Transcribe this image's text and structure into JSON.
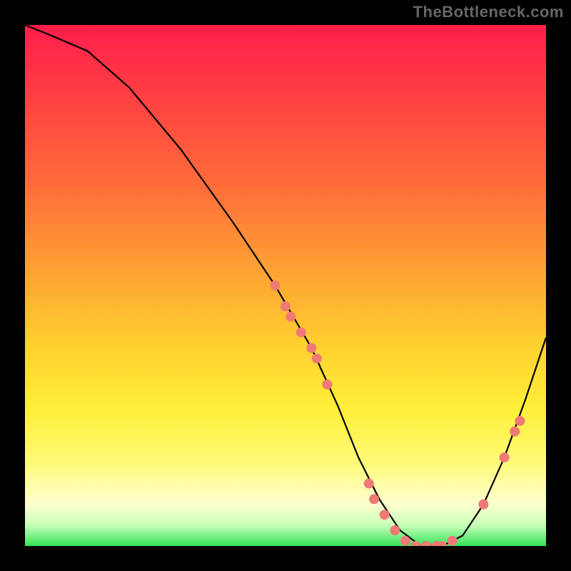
{
  "watermark": "TheBottleneck.com",
  "chart_data": {
    "type": "line",
    "title": "",
    "xlabel": "",
    "ylabel": "",
    "xlim": [
      0,
      100
    ],
    "ylim": [
      0,
      100
    ],
    "series": [
      {
        "name": "bottleneck-curve",
        "x": [
          0,
          5,
          12,
          20,
          30,
          40,
          48,
          55,
          60,
          64,
          68,
          72,
          76,
          80,
          84,
          88,
          92,
          96,
          100
        ],
        "values": [
          100,
          98,
          95,
          88,
          76,
          62,
          50,
          38,
          27,
          17,
          9,
          3,
          0,
          0,
          2,
          8,
          17,
          28,
          40
        ]
      }
    ],
    "markers": {
      "name": "highlighted-points",
      "color": "#ef7a75",
      "points": [
        {
          "x": 48,
          "y": 50
        },
        {
          "x": 50,
          "y": 46
        },
        {
          "x": 51,
          "y": 44
        },
        {
          "x": 53,
          "y": 41
        },
        {
          "x": 55,
          "y": 38
        },
        {
          "x": 56,
          "y": 36
        },
        {
          "x": 58,
          "y": 31
        },
        {
          "x": 66,
          "y": 12
        },
        {
          "x": 67,
          "y": 9
        },
        {
          "x": 69,
          "y": 6
        },
        {
          "x": 71,
          "y": 3
        },
        {
          "x": 73,
          "y": 1
        },
        {
          "x": 75,
          "y": 0
        },
        {
          "x": 77,
          "y": 0
        },
        {
          "x": 79,
          "y": 0
        },
        {
          "x": 80,
          "y": 0
        },
        {
          "x": 82,
          "y": 1
        },
        {
          "x": 88,
          "y": 8
        },
        {
          "x": 92,
          "y": 17
        },
        {
          "x": 94,
          "y": 22
        },
        {
          "x": 95,
          "y": 24
        }
      ]
    },
    "background_gradient": {
      "top": "#ff1f4b",
      "mid": "#ffd22f",
      "bottom": "#35e35a"
    }
  }
}
